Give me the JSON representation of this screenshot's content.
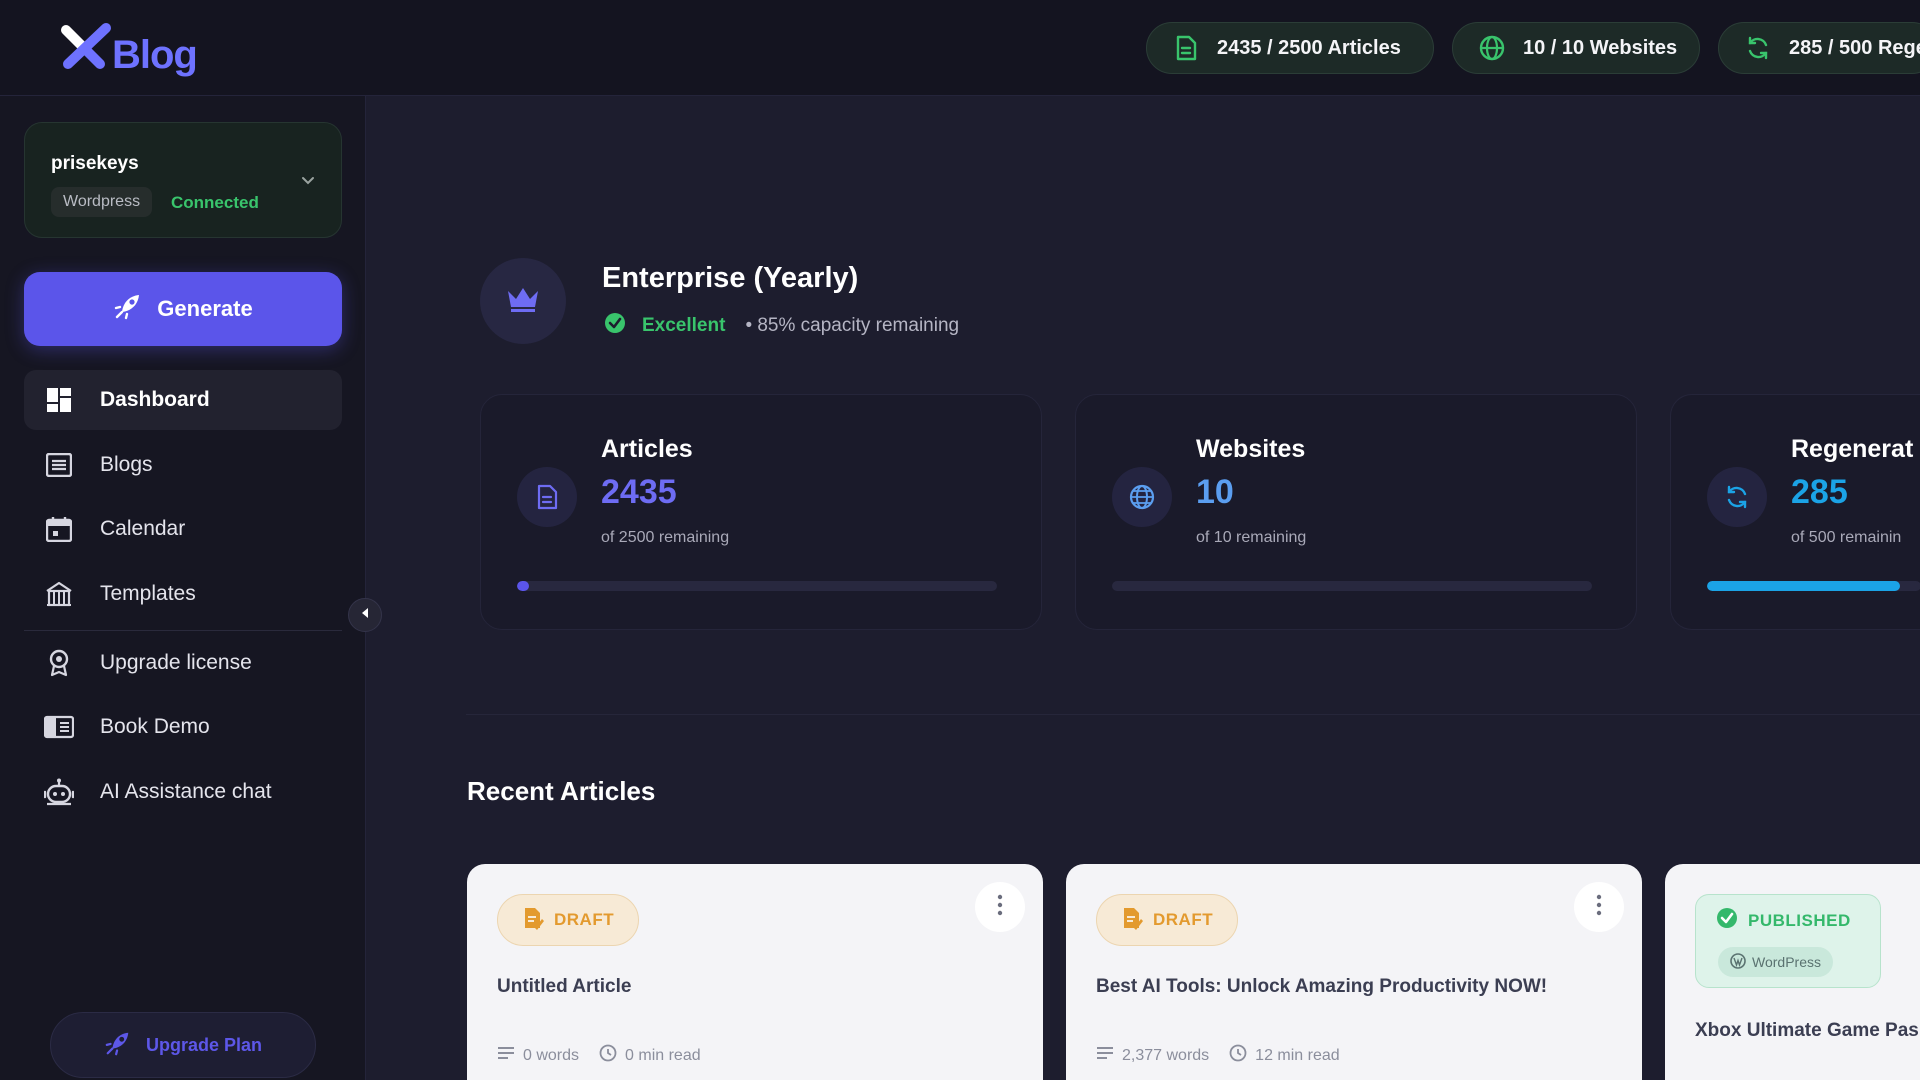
{
  "app": {
    "logo_text": "Blog"
  },
  "quotas": [
    {
      "label": "2435 / 2500 Articles",
      "icon": "document-icon"
    },
    {
      "label": "10 / 10 Websites",
      "icon": "globe-icon"
    },
    {
      "label": "285 / 500 Rege",
      "icon": "refresh-icon"
    }
  ],
  "site": {
    "name": "prisekeys",
    "platform": "Wordpress",
    "status": "Connected"
  },
  "sidebar": {
    "generate_label": "Generate",
    "items": [
      {
        "label": "Dashboard",
        "icon": "dashboard-icon",
        "active": true
      },
      {
        "label": "Blogs",
        "icon": "blogs-icon"
      },
      {
        "label": "Calendar",
        "icon": "calendar-icon"
      },
      {
        "label": "Templates",
        "icon": "templates-icon"
      },
      {
        "label": "Upgrade license",
        "icon": "license-icon"
      },
      {
        "label": "Book Demo",
        "icon": "book-demo-icon"
      },
      {
        "label": "AI Assistance chat",
        "icon": "robot-icon"
      }
    ],
    "upgrade_plan_label": "Upgrade Plan"
  },
  "plan": {
    "title": "Enterprise (Yearly)",
    "status": "Excellent",
    "capacity": "• 85% capacity remaining"
  },
  "stats": [
    {
      "label": "Articles",
      "value": "2435",
      "sub": "of 2500 remaining",
      "fill_fraction": 0.02,
      "fill_color": "#5b55ea",
      "icon": "document-icon"
    },
    {
      "label": "Websites",
      "value": "10",
      "sub": "of 10 remaining",
      "fill_fraction": 0.0,
      "fill_color": "#5b9ef0",
      "icon": "globe-icon"
    },
    {
      "label": "Regenerat",
      "value": "285",
      "sub": "of 500 remainin",
      "fill_fraction": 0.9,
      "fill_color": "#1ba3e6",
      "icon": "refresh-icon"
    }
  ],
  "recent": {
    "title": "Recent Articles",
    "articles": [
      {
        "status": "DRAFT",
        "title": "Untitled Article",
        "words": "0 words",
        "read": "0 min read"
      },
      {
        "status": "DRAFT",
        "title": "Best AI Tools: Unlock Amazing Productivity NOW!",
        "words": "2,377 words",
        "read": "12 min read"
      },
      {
        "status": "PUBLISHED",
        "platform": "WordPress",
        "title": "Xbox Ultimate Game Pas Shocking Savings!"
      }
    ]
  },
  "colors": {
    "accent": "#5b55ea",
    "success": "#39c46c",
    "draft": "#e39a2e",
    "cyan": "#1ba3e6"
  }
}
